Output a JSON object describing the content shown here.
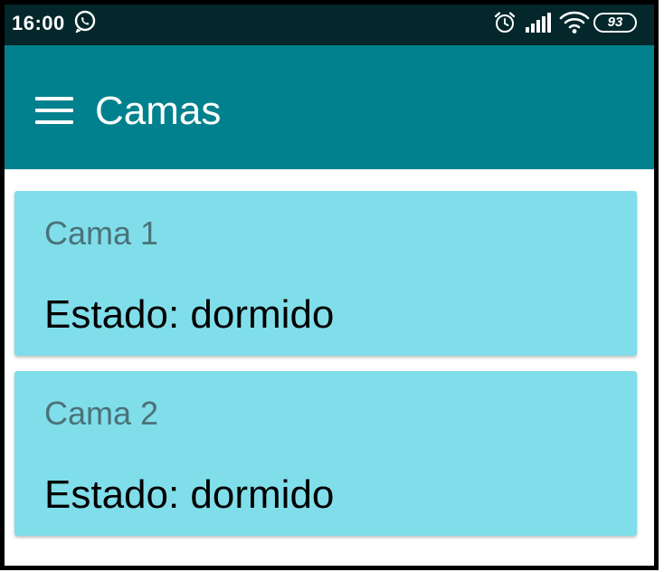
{
  "status_bar": {
    "time": "16:00",
    "battery": "93",
    "icons": [
      "whatsapp-icon",
      "alarm-icon",
      "signal-icon",
      "wifi-icon",
      "battery-icon"
    ]
  },
  "app_bar": {
    "title": "Camas",
    "menu_icon": "menu-icon",
    "color": "#00818d"
  },
  "beds": [
    {
      "name": "Cama 1",
      "state": "Estado: dormido"
    },
    {
      "name": "Cama 2",
      "state": "Estado: dormido"
    }
  ],
  "colors": {
    "status_bar": "#03272b",
    "card": "#80deea",
    "card_name": "#4a7278"
  }
}
